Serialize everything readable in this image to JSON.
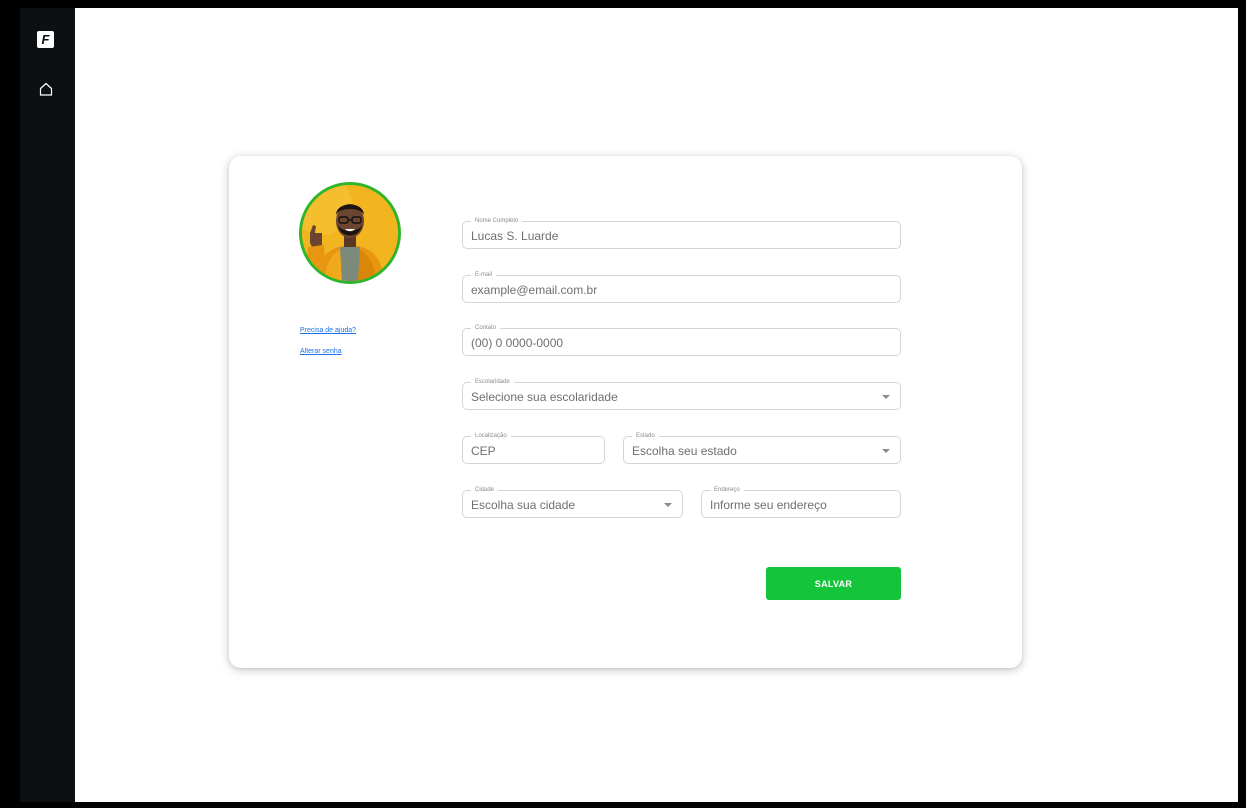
{
  "sidebar": {
    "logo_letter": "F",
    "nav": [
      {
        "icon": "home-icon"
      }
    ]
  },
  "profile": {
    "avatar_icon": "profile-photo",
    "links": {
      "help": "Precisa de ajuda?",
      "change_password": "Alterar senha"
    }
  },
  "form": {
    "nome": {
      "label": "Nome Completo",
      "value": "Lucas S. Luarde"
    },
    "email": {
      "label": "E-mail",
      "placeholder": "example@email.com.br"
    },
    "contato": {
      "label": "Contato",
      "placeholder": "(00) 0 0000-0000"
    },
    "escolaridade": {
      "label": "Escolaridade",
      "placeholder": "Selecione sua escolaridade"
    },
    "localizacao": {
      "label": "Localização",
      "placeholder": "CEP"
    },
    "estado": {
      "label": "Estado",
      "placeholder": "Escolha seu estado"
    },
    "cidade": {
      "label": "Cidade",
      "placeholder": "Escolha sua cidade"
    },
    "endereco": {
      "label": "Endereço",
      "placeholder": "Informe seu endereço"
    }
  },
  "actions": {
    "save_label": "SALVAR"
  },
  "colors": {
    "sidebar_bg": "#0d1013",
    "accent_green": "#14c43b",
    "avatar_ring": "#2fb52a",
    "link_blue": "#1a73e8"
  }
}
